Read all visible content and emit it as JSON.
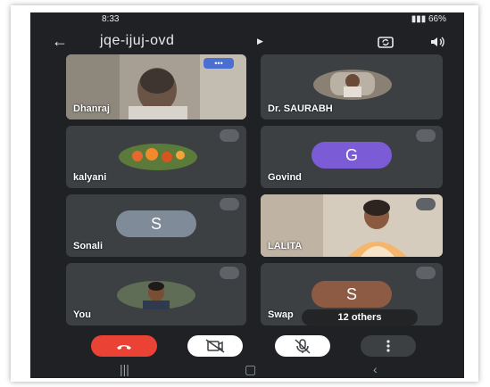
{
  "status_bar": {
    "time": "8:33",
    "battery": "66%"
  },
  "call": {
    "meeting_code": "jqe-ijuj-ovd"
  },
  "participants": [
    {
      "name": "Dhanraj",
      "type": "video",
      "muted": false,
      "more_label": "•••"
    },
    {
      "name": "Dr. SAURABH",
      "type": "photo",
      "muted": false
    },
    {
      "name": "kalyani",
      "type": "photo",
      "muted": true
    },
    {
      "name": "Govind",
      "type": "letter",
      "letter": "G",
      "avatar_color": "#7b5cd6",
      "muted": true
    },
    {
      "name": "Sonali",
      "type": "letter",
      "letter": "S",
      "avatar_color": "#7f8b99",
      "muted": true
    },
    {
      "name": "LALITA",
      "type": "video",
      "muted": true
    },
    {
      "name": "You",
      "type": "photo",
      "muted": true
    },
    {
      "name": "Swap",
      "type": "letter",
      "letter": "S",
      "avatar_color": "#8d5a44",
      "muted": true
    }
  ],
  "others_label": "12 others",
  "colors": {
    "end_call": "#ea4335",
    "background": "#202124",
    "tile": "#3c4043"
  }
}
